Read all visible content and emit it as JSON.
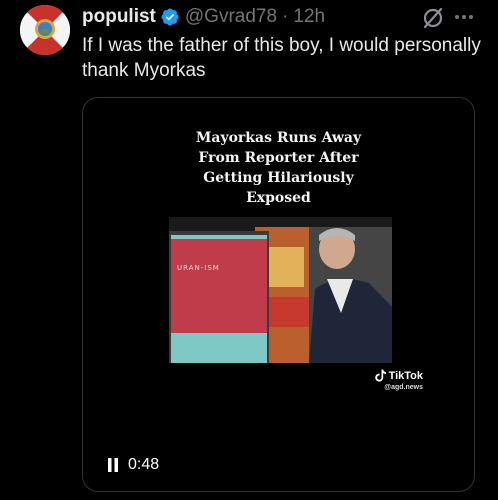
{
  "tweet": {
    "display_name": "populist",
    "handle": "@Gvrad78",
    "separator": "·",
    "time": "12h",
    "text": "If I was the father of this boy, I would personally thank Myorkas"
  },
  "media": {
    "video_title": "Mayorkas Runs Away\nFrom Reporter After\nGetting Hilariously\nExposed",
    "sign_text": "URAN-ISM",
    "watermark_brand": "TikTok",
    "watermark_handle": "@agd.news",
    "duration": "0:48"
  },
  "icons": {
    "verified": "verified-badge-icon",
    "grok": "grok-icon",
    "more": "more-options-icon",
    "pause": "pause-icon",
    "tiktok": "tiktok-logo-icon"
  },
  "colors": {
    "background": "#000000",
    "text_primary": "#e7e9ea",
    "text_secondary": "#71767b",
    "verified_blue": "#1d9bf0",
    "border": "#2f3336"
  }
}
